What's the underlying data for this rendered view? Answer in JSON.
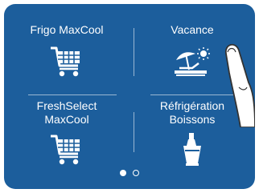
{
  "tiles": [
    {
      "label": "Frigo MaxCool",
      "icon": "shopping-cart-icon"
    },
    {
      "label": "Vacance",
      "icon": "beach-vacation-icon"
    },
    {
      "label": "FreshSelect\nMaxCool",
      "icon": "shopping-cart-icon"
    },
    {
      "label": "Réfrigération\nBoissons",
      "icon": "bottle-ice-bucket-icon"
    }
  ],
  "pagination": {
    "current_page": 1,
    "total_pages": 2
  },
  "colors": {
    "background": "#1c5e9c",
    "foreground": "#ffffff"
  }
}
